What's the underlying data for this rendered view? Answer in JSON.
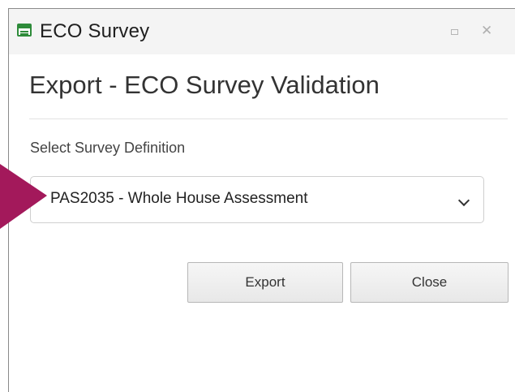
{
  "window": {
    "title": "ECO Survey",
    "icon": "form-window-icon"
  },
  "dialog": {
    "heading": "Export - ECO Survey Validation",
    "field_label": "Select Survey Definition",
    "select": {
      "selected_value": "PAS2035 - Whole House Assessment"
    },
    "buttons": {
      "export_label": "Export",
      "close_label": "Close"
    }
  },
  "annotation": {
    "arrow_color": "#a3195b"
  },
  "colors": {
    "icon_green": "#2e8b3a",
    "border": "#8a8a8a"
  }
}
